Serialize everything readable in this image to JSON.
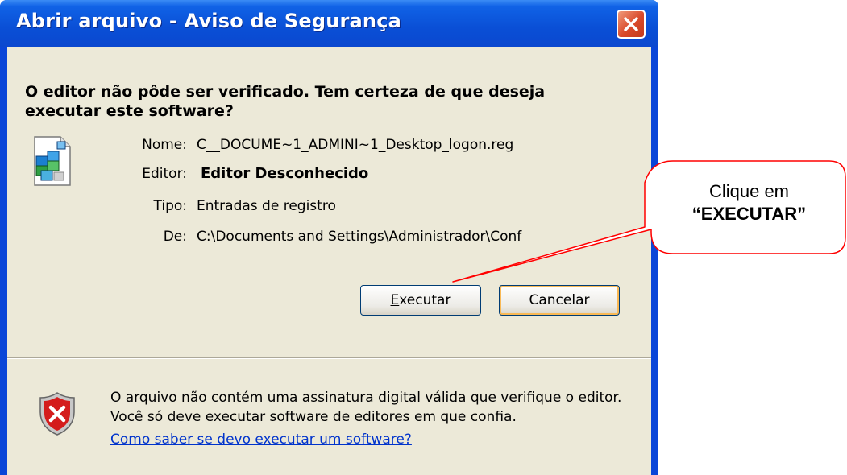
{
  "window": {
    "title": "Abrir arquivo - Aviso de Segurança"
  },
  "dialog": {
    "heading": "O editor não pôde ser verificado.  Tem certeza de que deseja executar este software?",
    "fields": [
      {
        "label": "Nome:",
        "value": "C__DOCUME~1_ADMINI~1_Desktop_logon.reg"
      },
      {
        "label": "Editor:",
        "value": "Editor Desconhecido"
      },
      {
        "label": "Tipo:",
        "value": "Entradas de registro"
      },
      {
        "label": "De:",
        "value": "C:\\Documents and Settings\\Administrador\\Conf"
      }
    ],
    "run_button_mnemonic": "E",
    "run_button_rest": "xecutar",
    "cancel_button": "Cancelar",
    "warning_text": "O arquivo não contém uma assinatura digital válida que verifique o editor.  Você só deve executar software de editores em que confia.",
    "warning_link": "Como saber se devo executar um software?"
  },
  "callout": {
    "line1": "Clique em",
    "line2": "“EXECUTAR”"
  },
  "icons": {
    "file": "registry-file-icon",
    "warning": "security-shield-icon",
    "close": "close-icon"
  },
  "colors": {
    "title_bar": "#0a4fd6",
    "dialog_bg": "#ece9d8",
    "close_button": "#d9492a",
    "link": "#0033cc",
    "callout_border": "#ff0000"
  }
}
